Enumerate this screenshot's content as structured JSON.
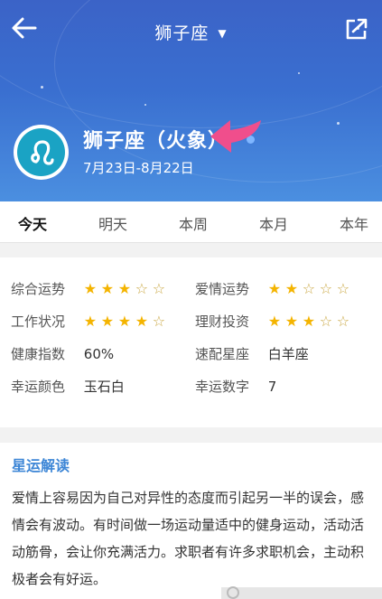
{
  "header": {
    "title": "狮子座"
  },
  "sign": {
    "name": "狮子座（火象）",
    "date_range": "7月23日-8月22日"
  },
  "tabs": [
    "今天",
    "明天",
    "本周",
    "本月",
    "本年"
  ],
  "active_tab": "今天",
  "fortune": {
    "overall_label": "综合运势",
    "overall_stars": 3,
    "love_label": "爱情运势",
    "love_stars": 2,
    "work_label": "工作状况",
    "work_stars": 4,
    "finance_label": "理财投资",
    "finance_stars": 3,
    "health_label": "健康指数",
    "health_value": "60%",
    "match_label": "速配星座",
    "match_value": "白羊座",
    "color_label": "幸运颜色",
    "color_value": "玉石白",
    "number_label": "幸运数字",
    "number_value": "7"
  },
  "reading": {
    "title": "星运解读",
    "text": "爱情上容易因为自己对异性的态度而引起另一半的误会，感情会有波动。有时间做一场运动量适中的健身运动，活动活动筋骨，会让你充满活力。求职者有许多求职机会，主动积极者会有好运。"
  },
  "colors": {
    "accent": "#3d86d6",
    "star": "#f4b400",
    "header_bg": "#3b63c7"
  }
}
